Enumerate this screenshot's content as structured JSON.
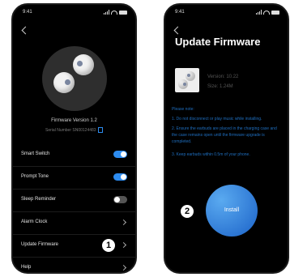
{
  "screen1": {
    "status_time": "9:41",
    "firmware_version": "Firmware Version 1.2",
    "serial": "Serial Number SN00124483",
    "menu": [
      {
        "label": "Smart Switch",
        "control": "toggle",
        "on": true
      },
      {
        "label": "Prompt Tone",
        "control": "toggle",
        "on": true
      },
      {
        "label": "Sleep Reminder",
        "control": "toggle",
        "on": false
      },
      {
        "label": "Alarm Clock",
        "control": "chevron"
      },
      {
        "label": "Update Firmware",
        "control": "chevron",
        "step": "1"
      },
      {
        "label": "Help",
        "control": "chevron"
      }
    ],
    "accent_color": "#2d8cf0"
  },
  "screen2": {
    "status_time": "9:41",
    "title": "Update Firmware",
    "version": "Version: 10.22",
    "size": "Size: 1.24M",
    "note_title": "Please note:",
    "notes": [
      "1. Do not disconnect or play music while installing.",
      "2. Ensure the earbuds are placed in the charging case and the case remains open until the firmware upgrade is completed.",
      "3. Keep earbuds within 0.5m of your phone."
    ],
    "install_label": "Install",
    "step": "2",
    "note_color": "#1f6fc0"
  },
  "icons": [
    "back-icon",
    "chevron-right-icon",
    "signal-icon",
    "wifi-icon",
    "battery-icon",
    "copy-icon"
  ]
}
